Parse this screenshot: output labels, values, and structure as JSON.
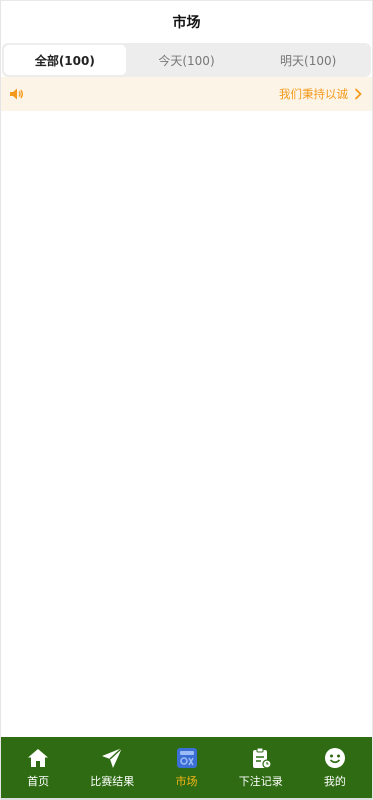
{
  "header": {
    "title": "市场"
  },
  "tabs": [
    {
      "label": "全部(100)",
      "active": true
    },
    {
      "label": "今天(100)",
      "active": false
    },
    {
      "label": "明天(100)",
      "active": false
    }
  ],
  "notice": {
    "text": "我们秉持以诚",
    "icon": "speaker-icon",
    "arrow_icon": "chevron-right-icon"
  },
  "tabbar": [
    {
      "label": "首页",
      "icon": "home-icon"
    },
    {
      "label": "比赛结果",
      "icon": "paper-plane-icon"
    },
    {
      "label": "市场",
      "icon": "market-icon",
      "active": true
    },
    {
      "label": "下注记录",
      "icon": "clipboard-icon"
    },
    {
      "label": "我的",
      "icon": "face-icon"
    }
  ],
  "colors": {
    "tabbar_bg": "#2e6b12",
    "active_label": "#f6b418",
    "notice_text": "#f39a1b",
    "notice_bg": "#fdf4e8"
  }
}
